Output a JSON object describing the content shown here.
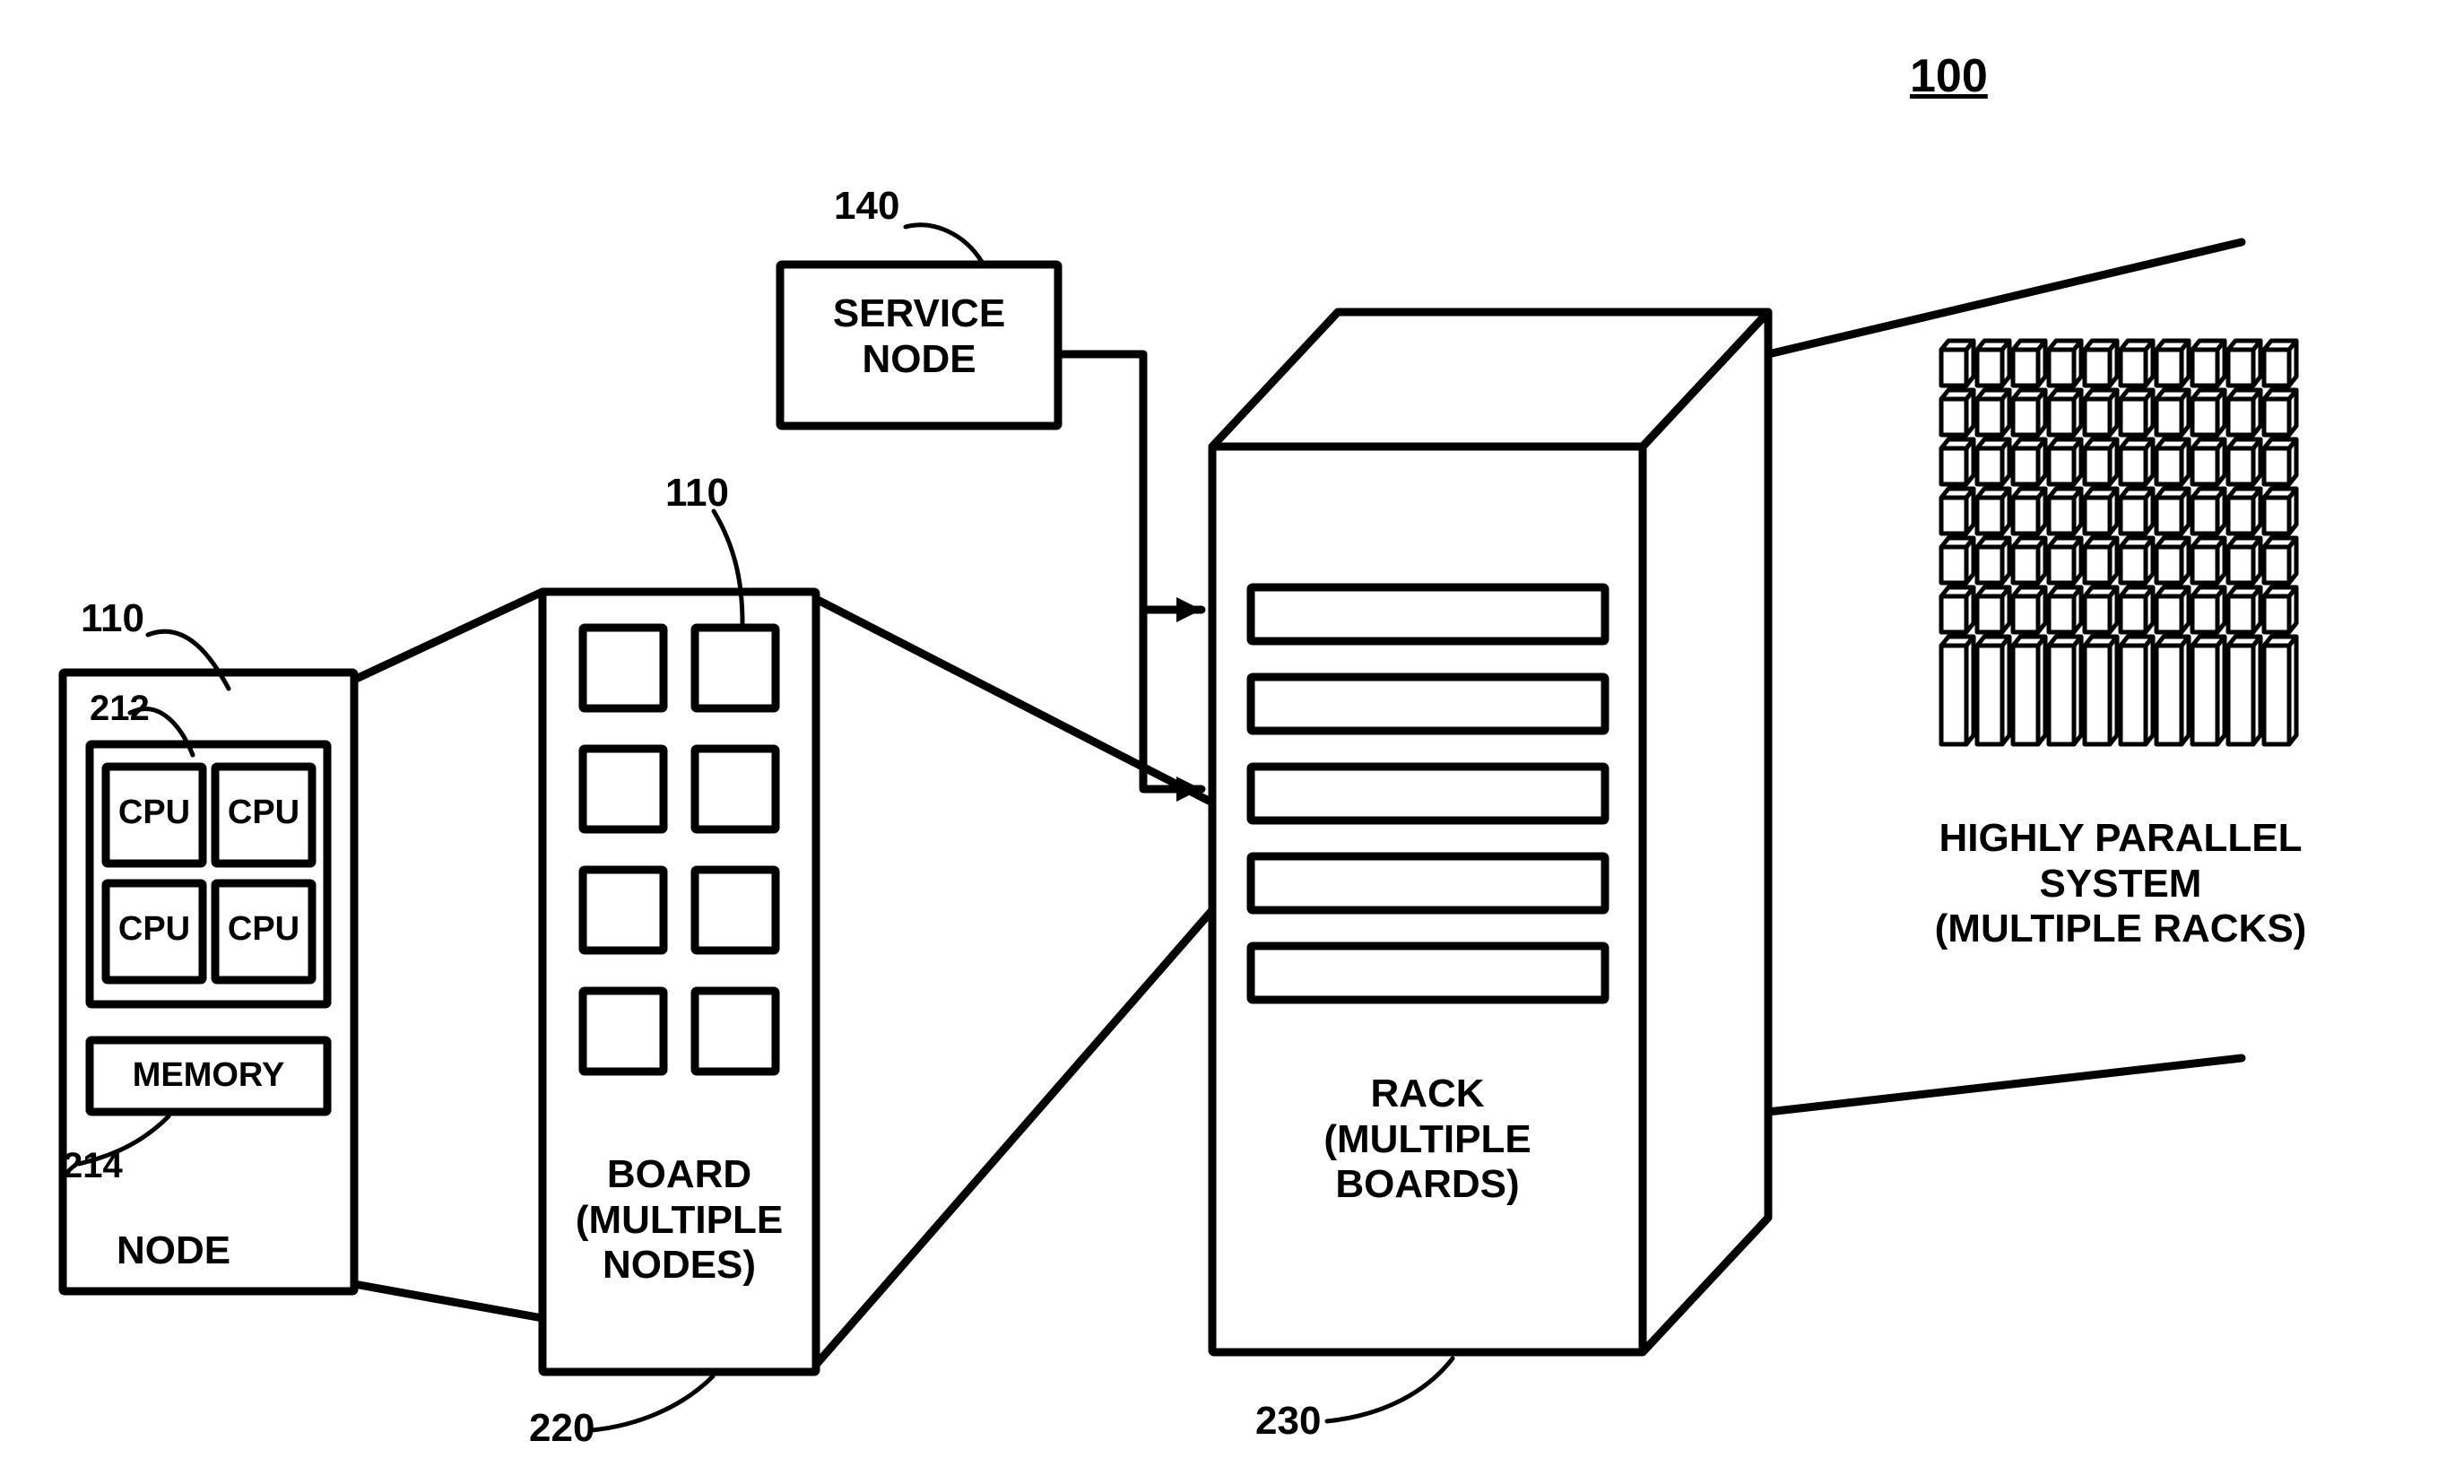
{
  "figure_ref": "100",
  "service_node": {
    "label": "SERVICE\nNODE",
    "ref": "140"
  },
  "node": {
    "ref": "110",
    "cpu_ref": "212",
    "mem_ref": "214",
    "cpu_label": "CPU",
    "memory_label": "MEMORY",
    "caption": "NODE"
  },
  "board": {
    "ref": "110",
    "out_ref": "220",
    "caption": "BOARD\n(MULTIPLE\nNODES)"
  },
  "rack": {
    "out_ref": "230",
    "caption": "RACK\n(MULTIPLE\nBOARDS)"
  },
  "system": {
    "caption": "HIGHLY PARALLEL\nSYSTEM\n(MULTIPLE RACKS)"
  }
}
